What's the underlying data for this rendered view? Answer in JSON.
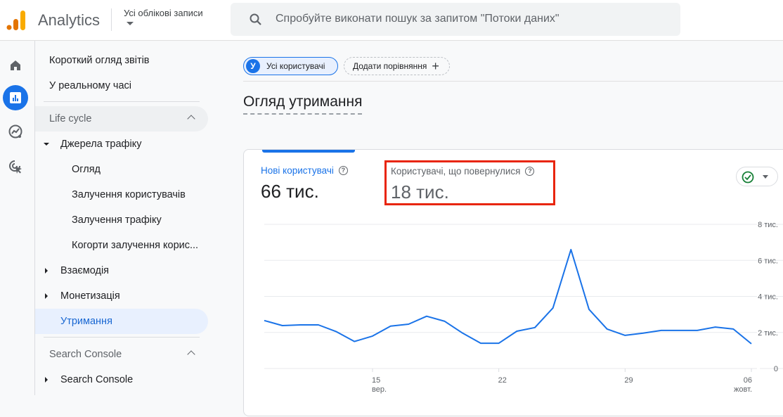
{
  "topbar": {
    "app_title": "Analytics",
    "account_selector": "Усі облікові записи",
    "search_placeholder": "Спробуйте виконати пошук за запитом \"Потоки даних\""
  },
  "rail": {
    "items": [
      {
        "icon": "home-icon",
        "active": false
      },
      {
        "icon": "reports-icon",
        "active": true
      },
      {
        "icon": "explore-icon",
        "active": false
      },
      {
        "icon": "advertising-icon",
        "active": false
      }
    ]
  },
  "nav": {
    "top_items": [
      "Короткий огляд звітів",
      "У реальному часі"
    ],
    "section1": {
      "title": "Life cycle",
      "groups": [
        {
          "label": "Джерела трафіку",
          "expanded": true,
          "children": [
            "Огляд",
            "Залучення користувачів",
            "Залучення трафіку",
            "Когорти залучення корис..."
          ]
        },
        {
          "label": "Взаємодія",
          "expanded": false
        },
        {
          "label": "Монетизація",
          "expanded": false
        }
      ],
      "selected": "Утримання"
    },
    "section2": {
      "title": "Search Console",
      "groups": [
        {
          "label": "Search Console",
          "expanded": false
        }
      ]
    }
  },
  "main": {
    "segment_chip": {
      "avatar_letter": "У",
      "label": "Усі користувачі"
    },
    "add_comparison": "Додати порівняння",
    "page_title": "Огляд утримання",
    "metrics": [
      {
        "label": "Нові користувачі",
        "value": "66 тис.",
        "active": true
      },
      {
        "label": "Користувачі, що повернулися",
        "value": "18 тис.",
        "active": false,
        "highlighted": true
      }
    ],
    "status_color": "#188038",
    "accent_color": "#1a73e8"
  },
  "chart_data": {
    "type": "line",
    "title": "",
    "xlabel": "",
    "ylabel": "",
    "series": [
      {
        "name": "Нові користувачі",
        "color": "#1a73e8",
        "values": [
          2.66,
          2.38,
          2.42,
          2.42,
          2.04,
          1.5,
          1.8,
          2.35,
          2.46,
          2.9,
          2.62,
          1.96,
          1.4,
          1.4,
          2.07,
          2.27,
          3.36,
          6.6,
          3.28,
          2.19,
          1.84,
          1.96,
          2.11,
          2.11,
          2.11,
          2.3,
          2.19,
          1.37
        ]
      }
    ],
    "x_count": 28,
    "x_ticks": [
      {
        "index": 6,
        "label": "15",
        "sublabel": "вер."
      },
      {
        "index": 13,
        "label": "22",
        "sublabel": ""
      },
      {
        "index": 20,
        "label": "29",
        "sublabel": ""
      },
      {
        "index": 27,
        "label": "06",
        "sublabel": "жовт."
      }
    ],
    "y_ticks": [
      {
        "value": 0,
        "label": "0"
      },
      {
        "value": 2,
        "label": "2 тис."
      },
      {
        "value": 4,
        "label": "4 тис."
      },
      {
        "value": 6,
        "label": "6 тис."
      },
      {
        "value": 8,
        "label": "8 тис."
      }
    ],
    "ylim": [
      0,
      8
    ],
    "y_unit": "тис.",
    "grid": true,
    "y_axis_position": "right"
  }
}
